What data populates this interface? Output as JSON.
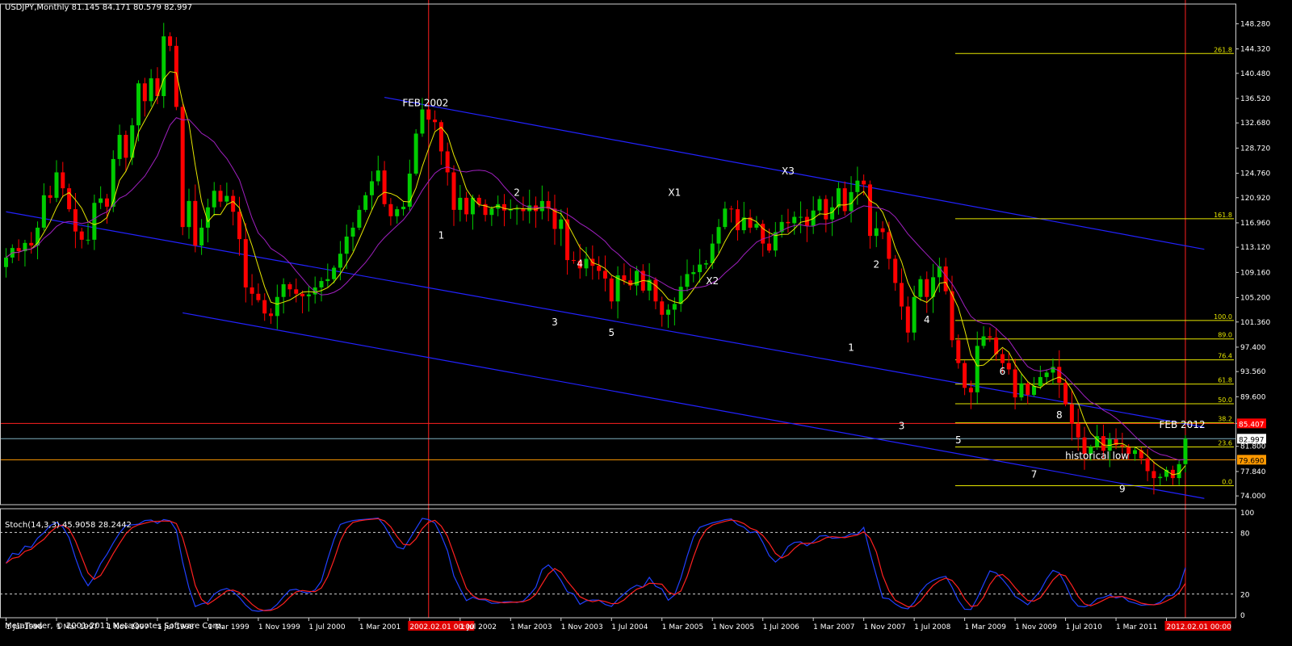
{
  "header": {
    "symbol": "USDJPY,Monthly",
    "ohlc": "81.145 84.171 80.579 82.997"
  },
  "stoch_header": {
    "name": "Stoch(14,3,3)",
    "values": "45.9058 28.2442"
  },
  "footer": {
    "copyright": "MetaTrader, © 2001-2011 MetaQuotes Software Corp."
  },
  "colors": {
    "background": "#000000",
    "bull": "#00cc00",
    "bear": "#ff0000",
    "ma_fast": "#e6e600",
    "ma_slow": "#a020c0",
    "channel": "#2222ff",
    "fib": "#e6e600",
    "vline": "#ff2020",
    "stoch_main": "#2040ff",
    "stoch_signal": "#ff2020",
    "text": "#ffffff"
  },
  "chart_data": {
    "type": "candlestick",
    "title": "USDJPY,Monthly",
    "price_axis": {
      "ticks": [
        74.0,
        77.84,
        81.8,
        85.407,
        89.6,
        93.56,
        97.4,
        101.36,
        105.2,
        109.16,
        113.12,
        116.96,
        120.92,
        124.76,
        128.72,
        132.68,
        136.52,
        140.48,
        144.32,
        148.28
      ],
      "tick_labels": [
        "74.000",
        "77.840",
        "81.800",
        "85.407",
        "89.600",
        "93.560",
        "97.400",
        "101.360",
        "105.200",
        "109.160",
        "113.120",
        "116.960",
        "120.920",
        "124.760",
        "128.720",
        "132.680",
        "136.520",
        "140.480",
        "144.320",
        "148.280"
      ],
      "ylim": [
        73.0,
        151.0
      ]
    },
    "time_axis": {
      "labels": [
        "1 Jul 1996",
        "1 Mar 1997",
        "1 Nov 1997",
        "1 Jul 1998",
        "1 Mar 1999",
        "1 Nov 1999",
        "1 Jul 2000",
        "1 Mar 2001",
        "2002.02.01 00:00",
        "1 Jul 2002",
        "1 Mar 2003",
        "1 Nov 2003",
        "1 Jul 2004",
        "1 Mar 2005",
        "1 Nov 2005",
        "1 Jul 2006",
        "1 Mar 2007",
        "1 Nov 2007",
        "1 Jul 2008",
        "1 Mar 2009",
        "1 Nov 2009",
        "1 Jul 2010",
        "1 Mar 2011",
        "2012.02.01 00:00"
      ],
      "highlighted": [
        "2002.02.01 00:00",
        "2012.02.01 00:00"
      ]
    },
    "price_markers": [
      {
        "label": "85.407",
        "value": 85.407,
        "color": "#ff0000",
        "text_color": "#ffffff"
      },
      {
        "label": "82.997",
        "value": 82.997,
        "color": "#ffffff",
        "text_color": "#000000"
      },
      {
        "label": "79.690",
        "value": 79.69,
        "color": "#ff9900",
        "text_color": "#000000"
      }
    ],
    "horizontal_lines": [
      {
        "value": 85.407,
        "color": "#ff2020"
      },
      {
        "value": 82.997,
        "color": "#7fb0c0"
      },
      {
        "value": 79.69,
        "color": "#ff9900"
      }
    ],
    "fib_levels": [
      {
        "label": "261.8",
        "value": 143.6
      },
      {
        "label": "161.8",
        "value": 117.6
      },
      {
        "label": "100.0",
        "value": 101.6
      },
      {
        "label": "89.0",
        "value": 98.7
      },
      {
        "label": "76.4",
        "value": 95.4
      },
      {
        "label": "61.8",
        "value": 91.6
      },
      {
        "label": "50.0",
        "value": 88.5
      },
      {
        "label": "38.2",
        "value": 85.5
      },
      {
        "label": "23.6",
        "value": 81.7
      },
      {
        "label": "0.0",
        "value": 75.6
      }
    ],
    "annotations": [
      {
        "text": "FEB 2002",
        "month": 66.5,
        "price": 135.3
      },
      {
        "text": "FEB 2012",
        "month": 186.5,
        "price": 84.7
      },
      {
        "text": "historical low",
        "month": 173.0,
        "price": 79.8
      },
      {
        "text": "1",
        "month": 69,
        "price": 114.5
      },
      {
        "text": "2",
        "month": 81,
        "price": 121.2
      },
      {
        "text": "3",
        "month": 87,
        "price": 100.8
      },
      {
        "text": "4",
        "month": 91,
        "price": 110.0
      },
      {
        "text": "5",
        "month": 96,
        "price": 99.2
      },
      {
        "text": "X1",
        "month": 106,
        "price": 121.2
      },
      {
        "text": "X2",
        "month": 112,
        "price": 107.3
      },
      {
        "text": "X3",
        "month": 124,
        "price": 124.6
      },
      {
        "text": "1",
        "month": 134,
        "price": 96.8
      },
      {
        "text": "2",
        "month": 138,
        "price": 109.9
      },
      {
        "text": "3",
        "month": 142,
        "price": 84.5
      },
      {
        "text": "4",
        "month": 146,
        "price": 101.2
      },
      {
        "text": "5",
        "month": 151,
        "price": 82.3
      },
      {
        "text": "6",
        "month": 158,
        "price": 93.1
      },
      {
        "text": "7",
        "month": 163,
        "price": 76.9
      },
      {
        "text": "8",
        "month": 167,
        "price": 86.2
      },
      {
        "text": "9",
        "month": 177,
        "price": 74.6
      }
    ],
    "channels": [
      {
        "from": {
          "month": 60,
          "price": 136.7
        },
        "to": {
          "month": 190,
          "price": 112.8
        }
      },
      {
        "from": {
          "month": 0,
          "price": 118.7
        },
        "to": {
          "month": 190,
          "price": 84.8
        }
      },
      {
        "from": {
          "month": 28,
          "price": 102.8
        },
        "to": {
          "month": 190,
          "price": 73.6
        }
      }
    ],
    "series": [
      {
        "name": "USDJPY",
        "type": "candlestick",
        "start": "1 Jul 1996",
        "closes": [
          111.5,
          113.0,
          112.5,
          113.8,
          113.4,
          116.2,
          121.3,
          120.9,
          124.9,
          122.4,
          119.1,
          115.6,
          114.3,
          114.3,
          120.1,
          120.8,
          119.5,
          127.0,
          130.8,
          127.2,
          132.3,
          138.9,
          136.1,
          139.7,
          136.9,
          146.3,
          144.8,
          135.2,
          116.3,
          120.4,
          113.4,
          116.2,
          119.4,
          122.0,
          120.3,
          121.2,
          118.7,
          114.4,
          106.8,
          105.8,
          104.8,
          102.7,
          102.3,
          105.3,
          107.3,
          106.5,
          105.8,
          105.4,
          105.7,
          106.8,
          107.8,
          108.1,
          109.9,
          112.1,
          114.8,
          116.2,
          119.0,
          121.3,
          123.5,
          125.2,
          119.9,
          118.0,
          119.1,
          119.5,
          124.7,
          131.0,
          134.8,
          133.2,
          132.8,
          128.2,
          124.9,
          119.0,
          120.9,
          118.3,
          120.9,
          119.9,
          118.2,
          119.2,
          119.9,
          118.9,
          119.1,
          119.2,
          118.8,
          119.7,
          118.8,
          120.4,
          119.2,
          116.0,
          117.5,
          111.1,
          111.0,
          109.8,
          111.3,
          110.2,
          109.4,
          108.2,
          104.6,
          108.7,
          107.9,
          107.1,
          109.4,
          106.3,
          108.0,
          104.6,
          102.5,
          103.3,
          104.2,
          106.9,
          108.9,
          109.2,
          110.4,
          110.6,
          113.7,
          116.3,
          119.2,
          119.1,
          115.8,
          117.8,
          116.2,
          116.8,
          113.7,
          112.6,
          115.5,
          117.1,
          116.9,
          117.9,
          117.9,
          116.5,
          118.9,
          120.7,
          117.5,
          119.4,
          122.4,
          118.8,
          121.8,
          123.6,
          123.0,
          114.9,
          116.1,
          115.5,
          111.3,
          107.5,
          103.8,
          99.7,
          105.3,
          108.1,
          105.3,
          108.4,
          110.1,
          106.2,
          98.5,
          94.9,
          91.0,
          90.3,
          97.6,
          99.1,
          98.9,
          96.3,
          94.9,
          93.9,
          89.5,
          91.7,
          89.9,
          91.3,
          92.7,
          93.4,
          94.3,
          91.8,
          88.4,
          85.4,
          83.2,
          80.6,
          81.7,
          83.4,
          81.1,
          82.9,
          82.0,
          81.8,
          80.6,
          81.2,
          79.9,
          77.9,
          76.8,
          77.0,
          78.1,
          76.8,
          79.0,
          82.99
        ]
      }
    ],
    "moving_averages": [
      {
        "name": "fast",
        "period": 5,
        "color": "#e6e600"
      },
      {
        "name": "slow",
        "period": 13,
        "color": "#a020c0"
      }
    ],
    "stochastic": {
      "name": "Stoch(14,3,3)",
      "main": 45.9058,
      "signal": 28.2442,
      "levels": [
        80,
        20
      ],
      "axis_labels": [
        "100",
        "80",
        "20",
        "0"
      ]
    }
  }
}
